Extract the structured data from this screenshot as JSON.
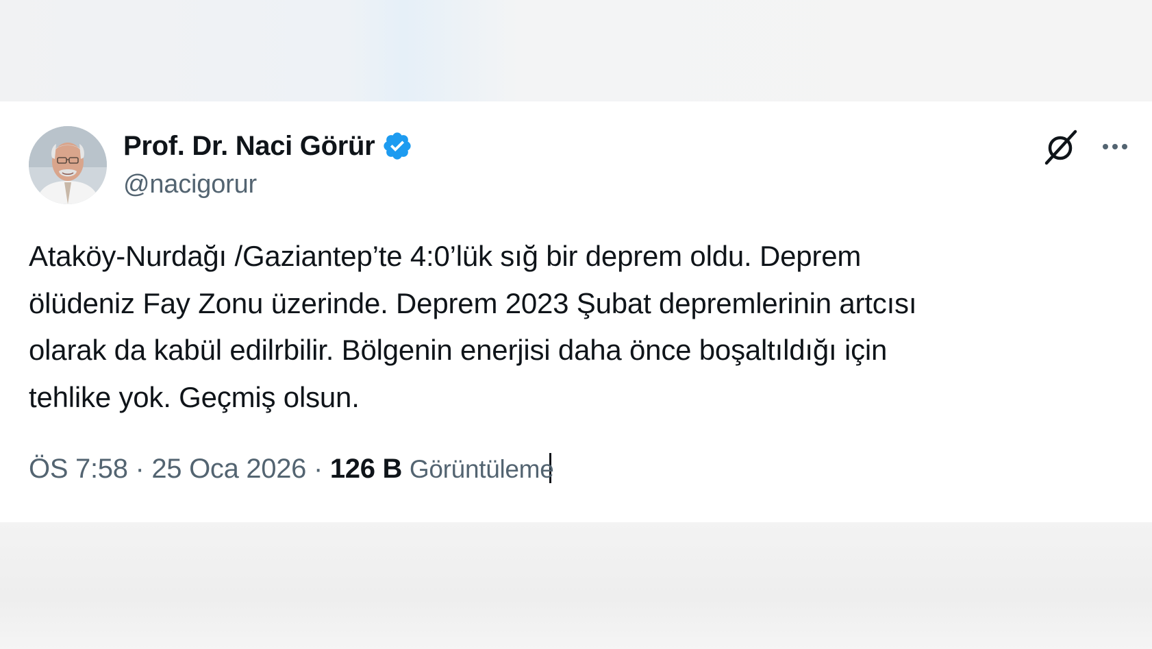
{
  "author": {
    "display_name": "Prof. Dr. Naci Görür",
    "handle": "@nacigorur",
    "verified": true,
    "accent_color": "#1d9bf0"
  },
  "icons": {
    "grok": "grok-icon",
    "more": "more-options-icon",
    "verified": "verified-badge-icon"
  },
  "tweet": {
    "lines": [
      "Ataköy-Nurdağı /Gaziantep’te 4:0’lük sığ bir deprem oldu. Deprem",
      "ölüdeniz Fay Zonu üzerinde. Deprem 2023 Şubat depremlerinin artcısı",
      "olarak da kabül edilrbilir. Bölgenin enerjisi daha önce boşaltıldığı için",
      "tehlike yok. Geçmiş olsun."
    ]
  },
  "meta": {
    "time": "ÖS 7:58",
    "separator": "·",
    "date": "25 Oca 2026",
    "views_count": "126 B",
    "views_label": "Görüntüleme"
  },
  "colors": {
    "text_primary": "#0f1419",
    "text_secondary": "#536471",
    "card_background": "#ffffff",
    "page_background": "#f2f3f4"
  }
}
